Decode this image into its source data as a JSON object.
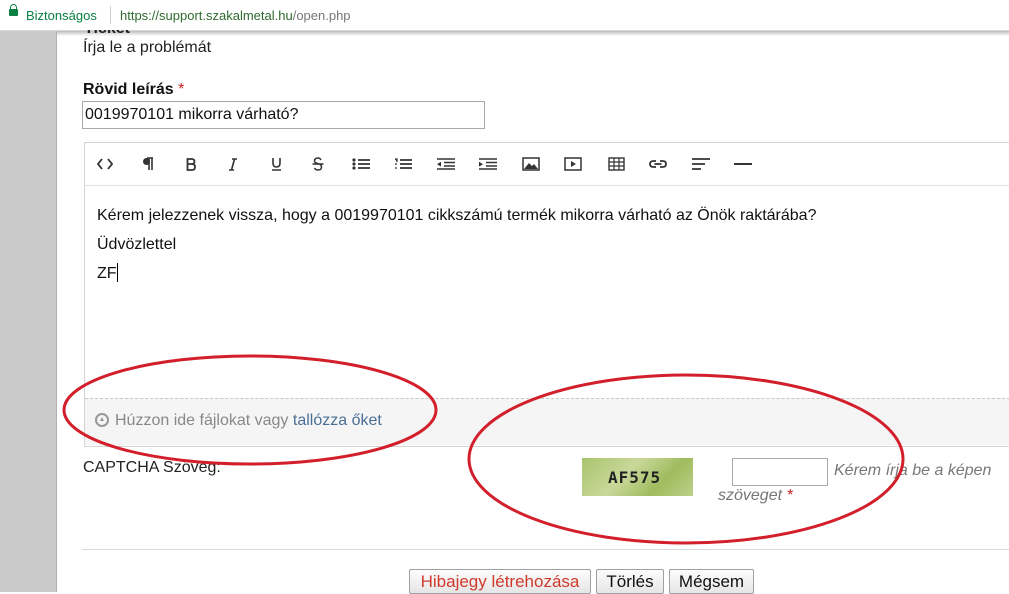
{
  "browser": {
    "secure_label": "Biztonságos",
    "url_host": "https://support.szakalmetal.hu",
    "url_path": "/open.php"
  },
  "form": {
    "subtitle": "Írja le a problémát",
    "summary_label": "Rövid leírás",
    "required_mark": "*",
    "summary_value": "0019970101 mikorra várható?",
    "toolbar_icons": [
      "code-icon",
      "paragraph-icon",
      "bold-icon",
      "italic-icon",
      "underline-icon",
      "strikethrough-icon",
      "unordered-list-icon",
      "ordered-list-icon",
      "outdent-icon",
      "indent-icon",
      "image-icon",
      "video-icon",
      "table-icon",
      "link-icon",
      "align-icon",
      "horizontal-rule-icon"
    ],
    "message_lines": [
      "Kérem jelezzenek vissza, hogy a 0019970101 cikkszámú termék mikorra várható az Önök raktárába?",
      "Üdvözlettel",
      "ZF"
    ],
    "dropzone_text": "Húzzon ide fájlokat vagy ",
    "dropzone_link": "tallózza őket",
    "captcha_label": "CAPTCHA Szöveg:",
    "captcha_code": "AF575",
    "captcha_hint_line1": "Kérem írja be a képen",
    "captcha_hint_line2": "szöveget",
    "buttons": {
      "create": "Hibajegy létrehozása",
      "reset": "Törlés",
      "cancel": "Mégsem"
    }
  },
  "colors": {
    "secure_green": "#0b8043",
    "required_red": "#cc1f1f",
    "annotation_red": "#d21f2b",
    "link_blue": "#4b6f94"
  }
}
